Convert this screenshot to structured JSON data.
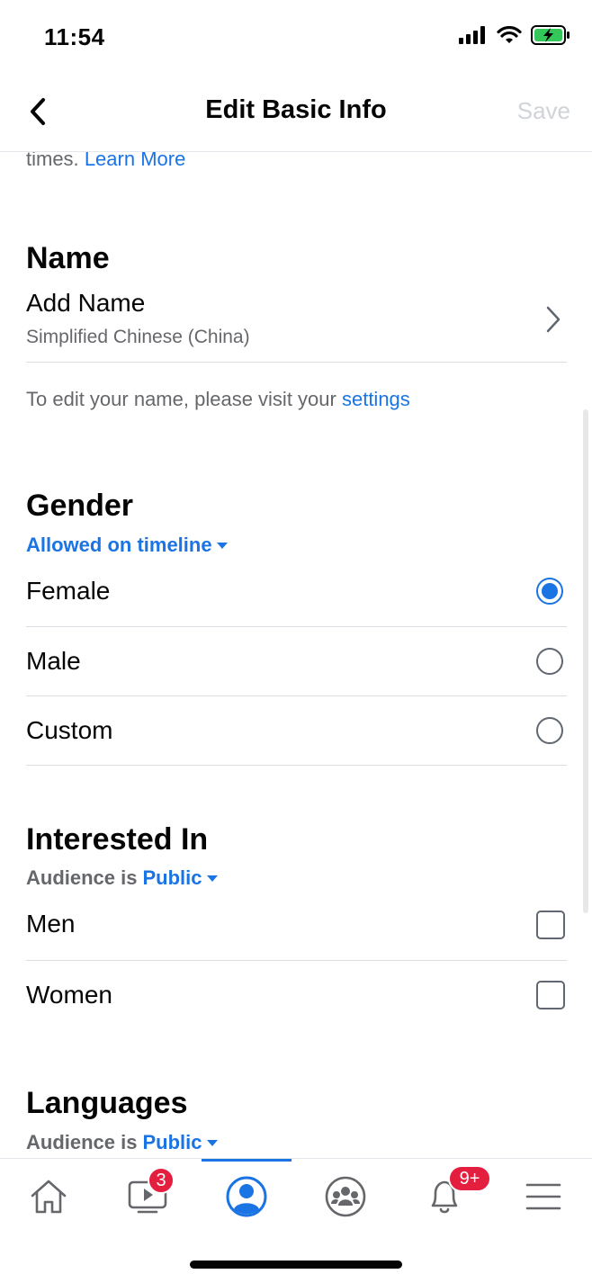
{
  "status_bar": {
    "time": "11:54"
  },
  "nav": {
    "title": "Edit Basic Info",
    "save_label": "Save"
  },
  "intro": {
    "text": "times.",
    "learn_more": "Learn More"
  },
  "name_section": {
    "title": "Name",
    "add_name": "Add Name",
    "language": "Simplified Chinese (China)",
    "note_prefix": "To edit your name, please visit your",
    "note_link": "settings"
  },
  "gender": {
    "title": "Gender",
    "audience": "Allowed on timeline",
    "options": [
      {
        "label": "Female",
        "selected": true
      },
      {
        "label": "Male",
        "selected": false
      },
      {
        "label": "Custom",
        "selected": false
      }
    ]
  },
  "interested": {
    "title": "Interested In",
    "audience_prefix": "Audience is",
    "audience": "Public",
    "options": [
      {
        "label": "Men",
        "checked": false
      },
      {
        "label": "Women",
        "checked": false
      }
    ]
  },
  "languages": {
    "title": "Languages",
    "audience_prefix": "Audience is",
    "audience": "Public"
  },
  "tab_bar": {
    "tabs": [
      "home-icon",
      "watch-icon",
      "profile-icon",
      "groups-icon",
      "notifications-icon",
      "menu-icon"
    ],
    "watch_badge": "3",
    "notifications_badge": "9+",
    "active": "profile-icon"
  },
  "colors": {
    "accent": "#1b74e4",
    "badge": "#e41e3f",
    "battery": "#34c759"
  }
}
